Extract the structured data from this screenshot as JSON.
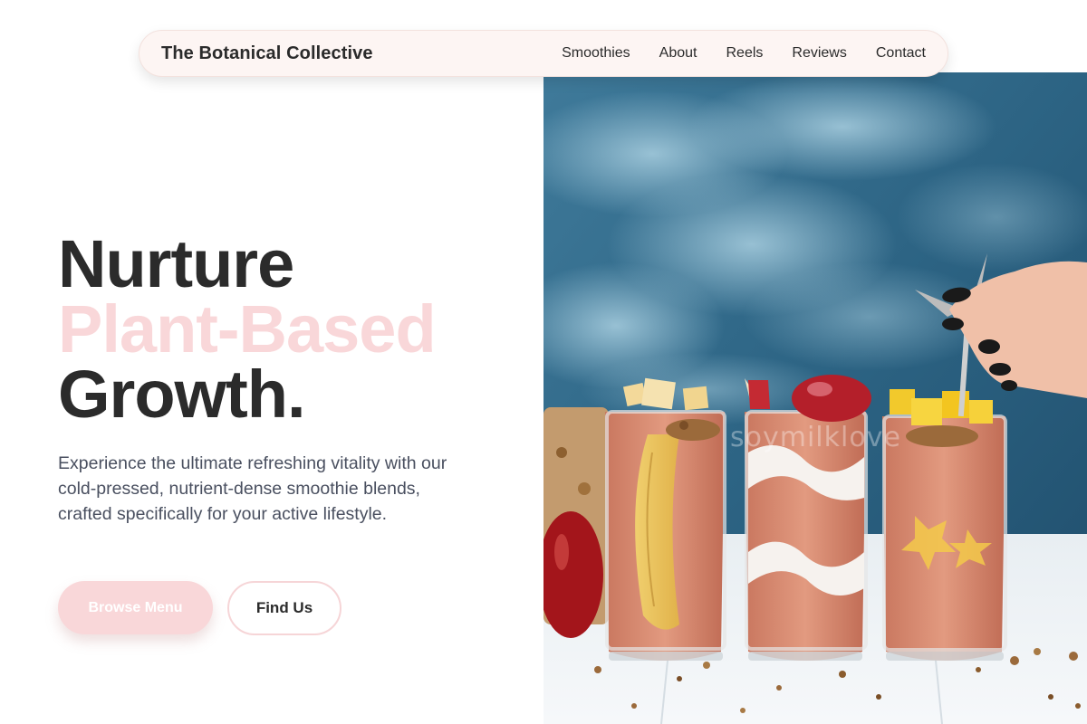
{
  "nav": {
    "brand": "The Botanical Collective",
    "links": [
      "Smoothies",
      "About",
      "Reels",
      "Reviews",
      "Contact"
    ]
  },
  "hero": {
    "headline_line1": "Nurture",
    "headline_line2": "Plant-Based",
    "headline_line3": "Growth.",
    "description": "Experience the ultimate refreshing vitality with our cold-pressed, nutrient-dense smoothie blends, crafted specifically for your active lifestyle.",
    "primary_button": "Browse Menu",
    "secondary_button": "Find Us",
    "image_watermark": "soymilklove"
  },
  "colors": {
    "accent_pink": "#f9d7d9",
    "text_dark": "#2b2b2b",
    "text_muted": "#4a5060",
    "nav_background": "#fdf5f3"
  }
}
